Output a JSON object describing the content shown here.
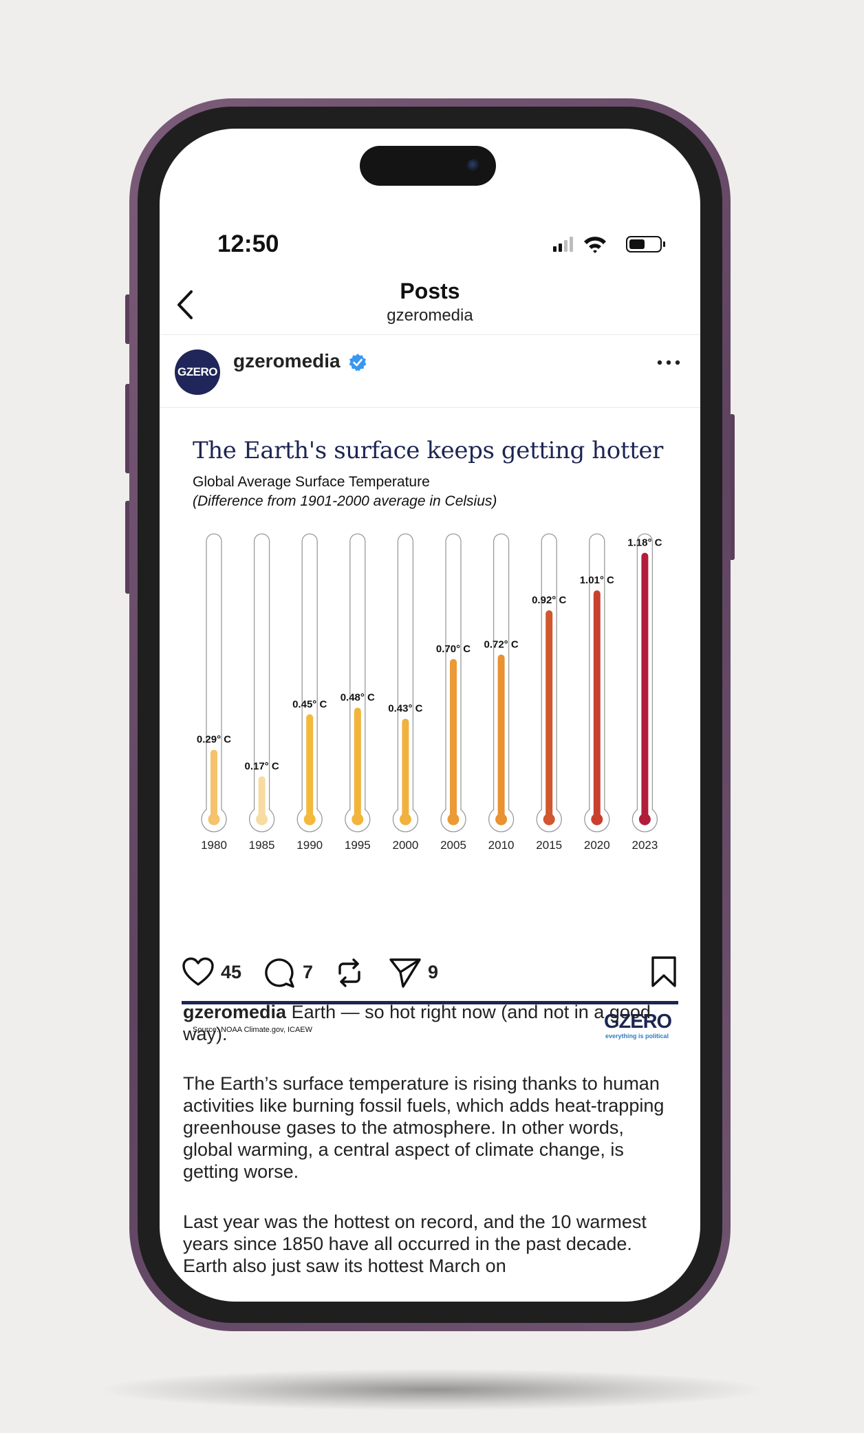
{
  "status_bar": {
    "time": "12:50"
  },
  "nav": {
    "title": "Posts",
    "subtitle": "gzeromedia"
  },
  "post": {
    "avatar_text": "GZERO",
    "username": "gzeromedia",
    "verified": true
  },
  "image": {
    "source": "Source: NOAA Climate.gov, ICAEW",
    "brand": "GZERO",
    "brand_tagline": "everything is political"
  },
  "chart_data": {
    "type": "bar",
    "title": "The Earth's surface keeps getting hotter",
    "subtitle": "Global Average Surface Temperature",
    "note": "(Difference from 1901-2000 average in Celsius)",
    "categories": [
      "1980",
      "1985",
      "1990",
      "1995",
      "2000",
      "2005",
      "2010",
      "2015",
      "2020",
      "2023"
    ],
    "values": [
      0.29,
      0.17,
      0.45,
      0.48,
      0.43,
      0.7,
      0.72,
      0.92,
      1.01,
      1.18
    ],
    "labels": [
      "0.29° C",
      "0.17° C",
      "0.45° C",
      "0.48° C",
      "0.43° C",
      "0.70° C",
      "0.72° C",
      "0.92° C",
      "1.01° C",
      "1.18° C"
    ],
    "colors": [
      "#f5c36b",
      "#f6dca0",
      "#f2b93b",
      "#f2b43a",
      "#f0b13f",
      "#ec9a35",
      "#e89231",
      "#d2562f",
      "#c9402f",
      "#b11e3a"
    ],
    "ylim": [
      0,
      1.25
    ],
    "grid": false,
    "legend": "none"
  },
  "actions": {
    "likes": "45",
    "comments": "7",
    "shares": "9"
  },
  "caption": {
    "username": "gzeromedia",
    "line1": "Earth — so hot right now (and not in a good way).",
    "para2": "The Earth’s surface temperature is rising thanks to human activities like burning fossil fuels, which adds heat-trapping greenhouse gases to the atmosphere. In other words, global warming, a central aspect of climate change, is getting worse.",
    "para3": "Last year was the hottest on record, and the 10 warmest years since 1850 have all occurred in the past decade. Earth also just saw its hottest March on"
  },
  "colors": {
    "brand_navy": "#1d2552",
    "verified_blue": "#3897f0",
    "phone_frame": "#6f5470"
  }
}
